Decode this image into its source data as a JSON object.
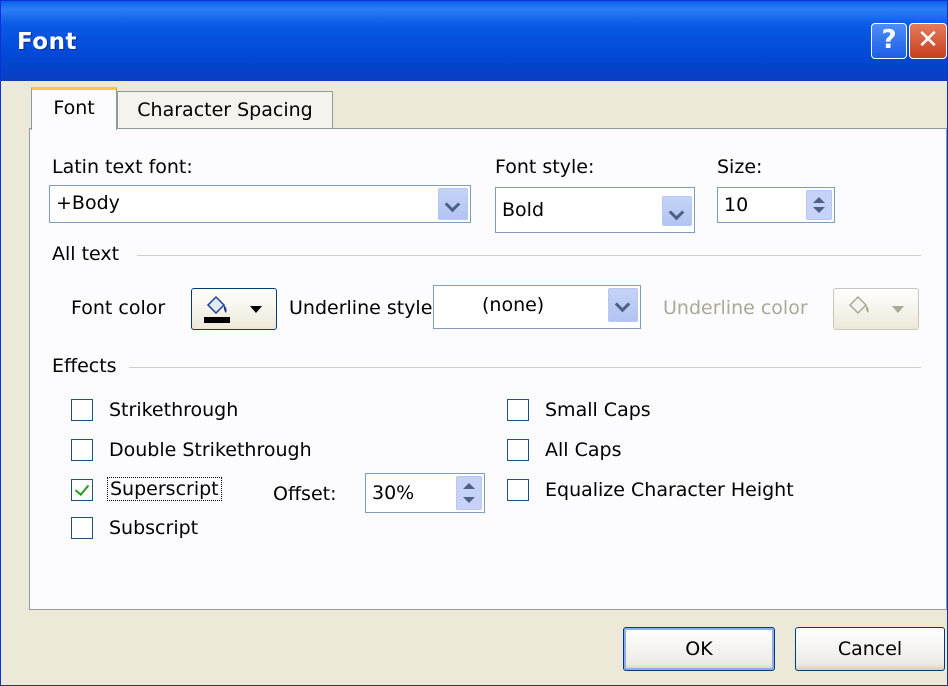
{
  "window": {
    "title": "Font"
  },
  "titlebar_buttons": {
    "help": "?",
    "close": "✕"
  },
  "tabs": [
    {
      "label": "Font",
      "active": true
    },
    {
      "label": "Character Spacing",
      "active": false
    }
  ],
  "font_section": {
    "latin_label": "Latin text font:",
    "latin_value": "+Body",
    "style_label": "Font style:",
    "style_value": "Bold",
    "size_label": "Size:",
    "size_value": "10"
  },
  "all_text": {
    "group_label": "All text",
    "font_color_label": "Font color",
    "underline_style_label": "Underline style",
    "underline_style_value": "(none)",
    "underline_color_label": "Underline color"
  },
  "effects": {
    "group_label": "Effects",
    "strikethrough": {
      "label": "Strikethrough",
      "checked": false
    },
    "double_strikethrough": {
      "label": "Double Strikethrough",
      "checked": false
    },
    "superscript": {
      "label": "Superscript",
      "checked": true
    },
    "subscript": {
      "label": "Subscript",
      "checked": false
    },
    "offset_label": "Offset:",
    "offset_value": "30%",
    "small_caps": {
      "label": "Small Caps",
      "checked": false
    },
    "all_caps": {
      "label": "All Caps",
      "checked": false
    },
    "equalize": {
      "label": "Equalize Character Height",
      "checked": false
    }
  },
  "buttons": {
    "ok": "OK",
    "cancel": "Cancel"
  },
  "icons": {
    "font_color": "paint-bucket-icon",
    "underline_color": "paint-bucket-icon"
  },
  "colors": {
    "titlebar": "#0a5ae6",
    "dialog_bg": "#ece9d8",
    "tab_highlight": "#ffc83c"
  }
}
